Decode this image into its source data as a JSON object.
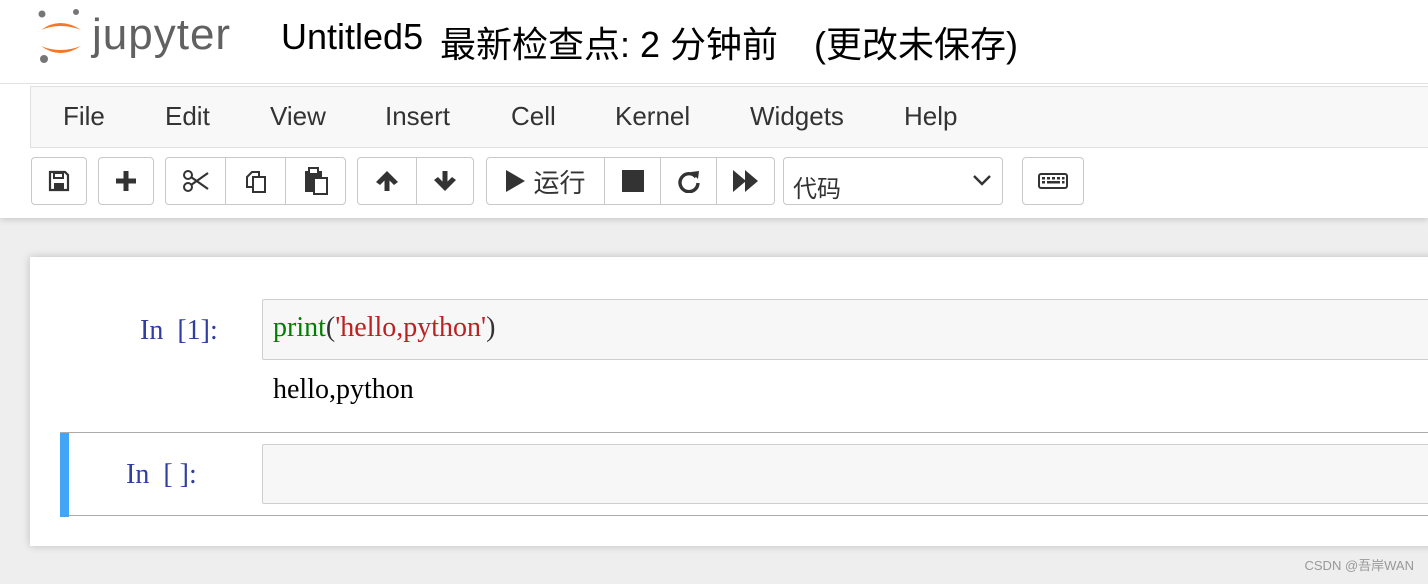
{
  "app": {
    "logo_text": "jupyter",
    "notebook_name": "Untitled5",
    "checkpoint": "最新检查点: 2 分钟前",
    "autosave": "(更改未保存)"
  },
  "menu": [
    "File",
    "Edit",
    "View",
    "Insert",
    "Cell",
    "Kernel",
    "Widgets",
    "Help"
  ],
  "toolbar": {
    "run_label": "运行",
    "cell_type": "代码",
    "icons": [
      "save-icon",
      "plus-icon",
      "scissors-icon",
      "copy-icon",
      "paste-icon",
      "arrow-up-icon",
      "arrow-down-icon",
      "play-icon",
      "stop-icon",
      "restart-icon",
      "fast-forward-icon",
      "keyboard-icon"
    ]
  },
  "cells": [
    {
      "prompt": "In  [1]:",
      "code": {
        "builtin": "print",
        "open": "(",
        "string": "'hello,python'",
        "close": ")"
      },
      "output": "hello,python"
    },
    {
      "prompt": "In  [ ]:",
      "code": ""
    }
  ],
  "watermark": "CSDN @吾岸WAN",
  "colors": {
    "prompt": "#303f9f",
    "builtin": "#008000",
    "string": "#ba2121",
    "selected_cell": "#42a5f5",
    "logo_orange": "#f37726"
  }
}
